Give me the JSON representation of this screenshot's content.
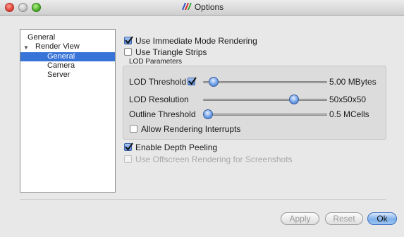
{
  "window": {
    "title": "Options"
  },
  "tree": {
    "items": [
      {
        "label": "General",
        "level": 0,
        "selected": false
      },
      {
        "label": "Render View",
        "level": 0,
        "selected": false,
        "expanded": true
      },
      {
        "label": "General",
        "level": 1,
        "selected": true
      },
      {
        "label": "Camera",
        "level": 1,
        "selected": false
      },
      {
        "label": "Server",
        "level": 1,
        "selected": false
      }
    ]
  },
  "options": {
    "immediate_mode": {
      "label": "Use Immediate Mode Rendering",
      "checked": true
    },
    "triangle_strips": {
      "label": "Use Triangle Strips",
      "checked": false
    },
    "lod_group_title": "LOD Parameters",
    "lod_threshold": {
      "label": "LOD Threshold",
      "checked": true,
      "value": "5.00 MBytes",
      "level": 0.05
    },
    "lod_resolution": {
      "label": "LOD Resolution",
      "value": "50x50x50",
      "level": 0.75
    },
    "outline_threshold": {
      "label": "Outline Threshold",
      "value": "0.5 MCells",
      "level": 0.0
    },
    "allow_interrupts": {
      "label": "Allow Rendering Interrupts",
      "checked": false
    },
    "depth_peeling": {
      "label": "Enable Depth Peeling",
      "checked": true
    },
    "offscreen_screenshots": {
      "label": "Use Offscreen Rendering for Screenshots",
      "checked": false,
      "disabled": true
    }
  },
  "buttons": {
    "apply": "Apply",
    "reset": "Reset",
    "ok": "Ok"
  }
}
